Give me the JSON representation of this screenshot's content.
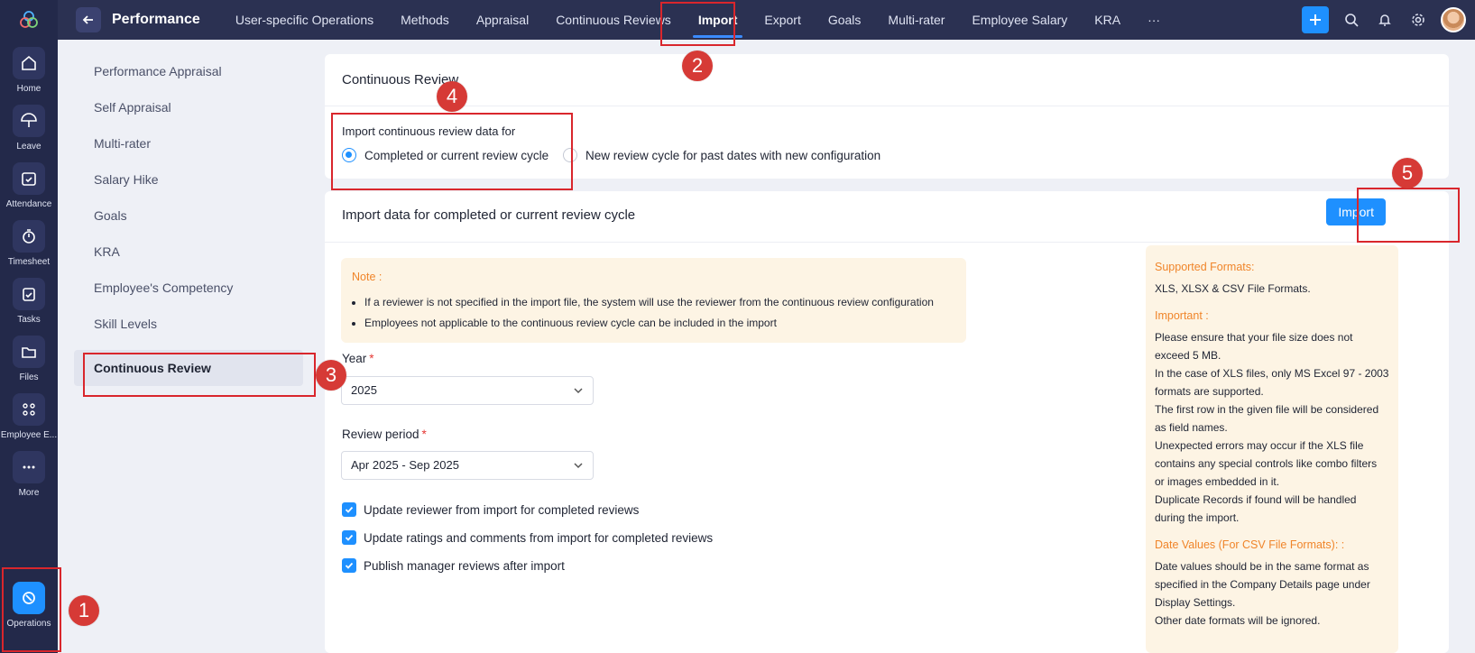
{
  "rail": {
    "items": [
      {
        "label": "Home",
        "icon": "home-icon"
      },
      {
        "label": "Leave",
        "icon": "umbrella-icon"
      },
      {
        "label": "Attendance",
        "icon": "calendar-check-icon"
      },
      {
        "label": "Timesheet",
        "icon": "timer-icon"
      },
      {
        "label": "Tasks",
        "icon": "clipboard-check-icon"
      },
      {
        "label": "Files",
        "icon": "folder-icon"
      },
      {
        "label": "Employee E...",
        "icon": "engagement-icon"
      },
      {
        "label": "More",
        "icon": "more-dots-icon"
      },
      {
        "label": "Operations",
        "icon": "operations-icon"
      }
    ]
  },
  "topbar": {
    "title": "Performance",
    "tabs": [
      "User-specific Operations",
      "Methods",
      "Appraisal",
      "Continuous Reviews",
      "Import",
      "Export",
      "Goals",
      "Multi-rater",
      "Employee Salary",
      "KRA",
      "···"
    ],
    "active_tab": "Import"
  },
  "sidebar": {
    "items": [
      "Performance Appraisal",
      "Self Appraisal",
      "Multi-rater",
      "Salary Hike",
      "Goals",
      "KRA",
      "Employee's Competency",
      "Skill Levels",
      "Continuous Review"
    ],
    "active": "Continuous Review"
  },
  "section1": {
    "title": "Continuous Review",
    "import_for_label": "Import continuous review data for",
    "option_completed": "Completed or current review cycle",
    "option_new": "New review cycle for past dates with new configuration",
    "selected": "Completed or current review cycle"
  },
  "section2": {
    "title": "Import data for completed or current review cycle",
    "import_button": "Import",
    "note_title": "Note :",
    "note_items": [
      "If a reviewer is not specified in the import file, the system will use the reviewer from the continuous review configuration",
      "Employees not applicable to the continuous review cycle can be included in the import"
    ],
    "year_label": "Year",
    "year_value": "2025",
    "period_label": "Review period",
    "period_value": "Apr 2025 - Sep 2025",
    "required_mark": "*",
    "checkboxes": [
      {
        "label": "Update reviewer from import for completed reviews",
        "checked": true
      },
      {
        "label": "Update ratings and comments from import for completed reviews",
        "checked": true
      },
      {
        "label": "Publish manager reviews after import",
        "checked": true
      }
    ]
  },
  "info": {
    "supported_title": "Supported Formats:",
    "supported_text": "XLS, XLSX & CSV File Formats.",
    "important_title": "Important :",
    "important_lines": [
      "Please ensure that your file size does not exceed 5 MB.",
      "In the case of XLS files, only MS Excel 97 - 2003 formats are supported.",
      "The first row in the given file will be considered as field names.",
      "Unexpected errors may occur if the XLS file contains any special controls like combo filters or images embedded in it.",
      "Duplicate Records if found will be handled during the import."
    ],
    "date_title": "Date Values (For CSV File Formats): :",
    "date_lines": [
      "Date values should be in the same format as specified in the Company Details page under Display Settings.",
      "Other date formats will be ignored."
    ]
  },
  "annotations": [
    "1",
    "2",
    "3",
    "4",
    "5"
  ],
  "colors": {
    "accent": "#1e90ff",
    "rail": "#23294a",
    "topbar": "#2b3152",
    "note_bg": "#fdf4e4",
    "note_title": "#f0852a",
    "annotation": "#d9262c"
  }
}
